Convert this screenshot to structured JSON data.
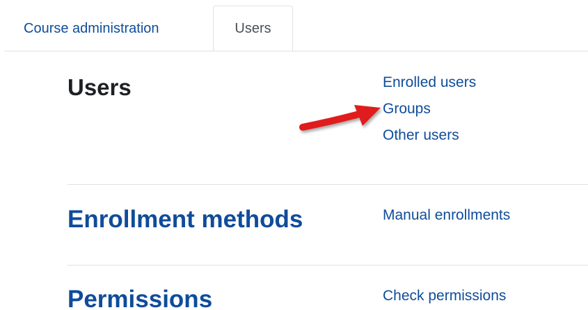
{
  "tabs": [
    {
      "label": "Course administration",
      "active": false
    },
    {
      "label": "Users",
      "active": true
    }
  ],
  "sections": {
    "users": {
      "heading": "Users",
      "links": [
        "Enrolled users",
        "Groups",
        "Other users"
      ]
    },
    "enrollment": {
      "heading": "Enrollment methods",
      "links": [
        "Manual enrollments"
      ]
    },
    "permissions": {
      "heading": "Permissions",
      "links": [
        "Check permissions"
      ]
    }
  },
  "colors": {
    "link": "#0f4c9a",
    "heading_dark": "#1d2125",
    "border": "#dee2e6",
    "arrow": "#e01b1b"
  },
  "annotation": {
    "icon": "red-arrow-icon",
    "points_to": "Groups"
  }
}
